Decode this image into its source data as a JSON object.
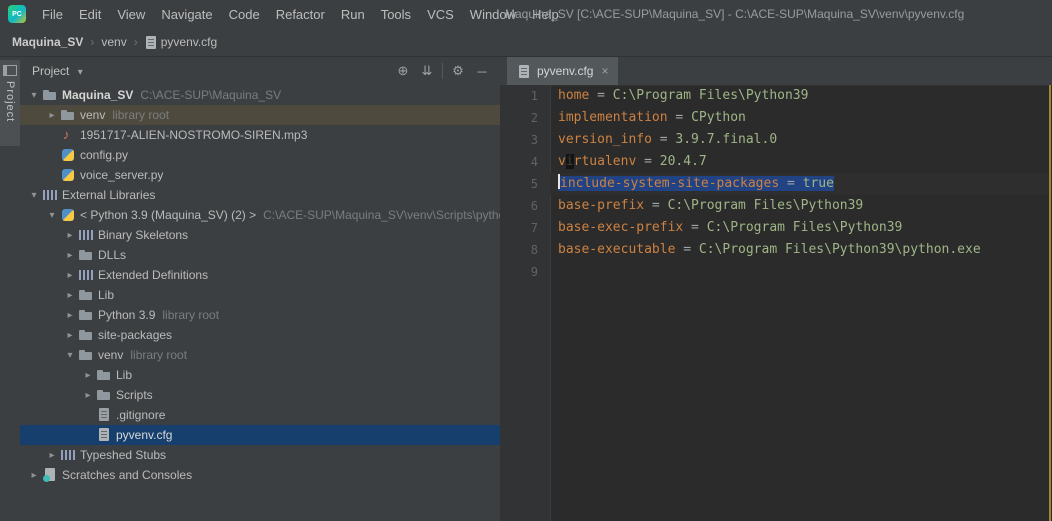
{
  "colors": {
    "selection": "#214283",
    "tree_selected": "#173f6d",
    "tree_highlight": "#4e4a3d",
    "key_color": "#cc8242",
    "value_color": "#9fb587",
    "panel_bg": "#3c3f41",
    "editor_bg": "#2b2b2b"
  },
  "glyphs": {
    "chevron_down": "▾",
    "chevron_right": "▸"
  },
  "titlebar": {
    "logo": "PC",
    "menu": [
      "File",
      "Edit",
      "View",
      "Navigate",
      "Code",
      "Refactor",
      "Run",
      "Tools",
      "VCS",
      "Window",
      "Help"
    ],
    "title": "Maquina_SV [C:\\ACE-SUP\\Maquina_SV] - C:\\ACE-SUP\\Maquina_SV\\venv\\pyvenv.cfg"
  },
  "breadcrumb": {
    "project": "Maquina_SV",
    "sep": "›",
    "folder": "venv",
    "file": "pyvenv.cfg"
  },
  "tool_stripe": {
    "label": "Project"
  },
  "project_panel": {
    "title": "Project",
    "caret": "▾",
    "toolbar": {
      "locate": "⊕",
      "collapse": "⇊",
      "settings": "⚙",
      "hide": "─"
    },
    "tree": [
      {
        "label": "Maquina_SV",
        "hint": "C:\\ACE-SUP\\Maquina_SV",
        "level": 0,
        "chevron": "down",
        "icon": "folder",
        "bold": true
      },
      {
        "label": "venv",
        "hint": "library root",
        "level": 1,
        "chevron": "right",
        "icon": "folder",
        "state": "highlight"
      },
      {
        "label": "1951717-ALIEN-NOSTROMO-SIREN.mp3",
        "level": 1,
        "icon": "audio"
      },
      {
        "label": "config.py",
        "level": 1,
        "icon": "python-file"
      },
      {
        "label": "voice_server.py",
        "level": 1,
        "icon": "python-file"
      },
      {
        "label": "External Libraries",
        "level": 0,
        "chevron": "down",
        "icon": "library"
      },
      {
        "label": "< Python 3.9 (Maquina_SV) (2) >",
        "hint": "C:\\ACE-SUP\\Maquina_SV\\venv\\Scripts\\pytho",
        "level": 1,
        "chevron": "down",
        "icon": "python"
      },
      {
        "label": "Binary Skeletons",
        "level": 2,
        "chevron": "right",
        "icon": "library"
      },
      {
        "label": "DLLs",
        "level": 2,
        "chevron": "right",
        "icon": "folder"
      },
      {
        "label": "Extended Definitions",
        "level": 2,
        "chevron": "right",
        "icon": "library"
      },
      {
        "label": "Lib",
        "level": 2,
        "chevron": "right",
        "icon": "folder"
      },
      {
        "label": "Python 3.9",
        "hint": "library root",
        "level": 2,
        "chevron": "right",
        "icon": "folder"
      },
      {
        "label": "site-packages",
        "level": 2,
        "chevron": "right",
        "icon": "folder"
      },
      {
        "label": "venv",
        "hint": "library root",
        "level": 2,
        "chevron": "down",
        "icon": "folder"
      },
      {
        "label": "Lib",
        "level": 3,
        "chevron": "right",
        "icon": "folder"
      },
      {
        "label": "Scripts",
        "level": 3,
        "chevron": "right",
        "icon": "folder"
      },
      {
        "label": ".gitignore",
        "level": 3,
        "icon": "gitignore"
      },
      {
        "label": "pyvenv.cfg",
        "level": 3,
        "icon": "text-file",
        "state": "selected"
      },
      {
        "label": "Typeshed Stubs",
        "level": 1,
        "chevron": "right",
        "icon": "library"
      },
      {
        "label": "Scratches and Consoles",
        "level": 0,
        "chevron": "right",
        "icon": "scratches"
      }
    ]
  },
  "editor": {
    "tab": {
      "label": "pyvenv.cfg",
      "close": "×"
    },
    "lines": [
      {
        "num": "1",
        "tokens": [
          {
            "t": "key",
            "v": "home"
          },
          {
            "t": "eq",
            "v": " = "
          },
          {
            "t": "val",
            "v": "C:\\Program Files\\Python39"
          }
        ]
      },
      {
        "num": "2",
        "tokens": [
          {
            "t": "key",
            "v": "implementation"
          },
          {
            "t": "eq",
            "v": " = "
          },
          {
            "t": "val",
            "v": "CPython"
          }
        ]
      },
      {
        "num": "3",
        "tokens": [
          {
            "t": "key",
            "v": "version_info"
          },
          {
            "t": "eq",
            "v": " = "
          },
          {
            "t": "val",
            "v": "3.9.7.final.0"
          }
        ]
      },
      {
        "num": "4",
        "tokens": [
          {
            "t": "key",
            "v": "v"
          },
          {
            "t": "block",
            "v": "i"
          },
          {
            "t": "key",
            "v": "rtualenv"
          },
          {
            "t": "eq",
            "v": " = "
          },
          {
            "t": "val",
            "v": "20.4.7"
          }
        ]
      },
      {
        "num": "5",
        "selected": true,
        "tokens": [
          {
            "t": "caret",
            "v": ""
          },
          {
            "t": "key",
            "v": "include-system-site-packages"
          },
          {
            "t": "eq",
            "v": " = "
          },
          {
            "t": "val",
            "v": "true"
          }
        ]
      },
      {
        "num": "6",
        "tokens": [
          {
            "t": "key",
            "v": "base-prefix"
          },
          {
            "t": "eq",
            "v": " = "
          },
          {
            "t": "val",
            "v": "C:\\Program Files\\Python39"
          }
        ]
      },
      {
        "num": "7",
        "tokens": [
          {
            "t": "key",
            "v": "base-exec-prefix"
          },
          {
            "t": "eq",
            "v": " = "
          },
          {
            "t": "val",
            "v": "C:\\Program Files\\Python39"
          }
        ]
      },
      {
        "num": "8",
        "tokens": [
          {
            "t": "key",
            "v": "base-executable"
          },
          {
            "t": "eq",
            "v": " = "
          },
          {
            "t": "val",
            "v": "C:\\Program Files\\Python39\\python.exe"
          }
        ]
      },
      {
        "num": "9",
        "tokens": []
      }
    ]
  }
}
